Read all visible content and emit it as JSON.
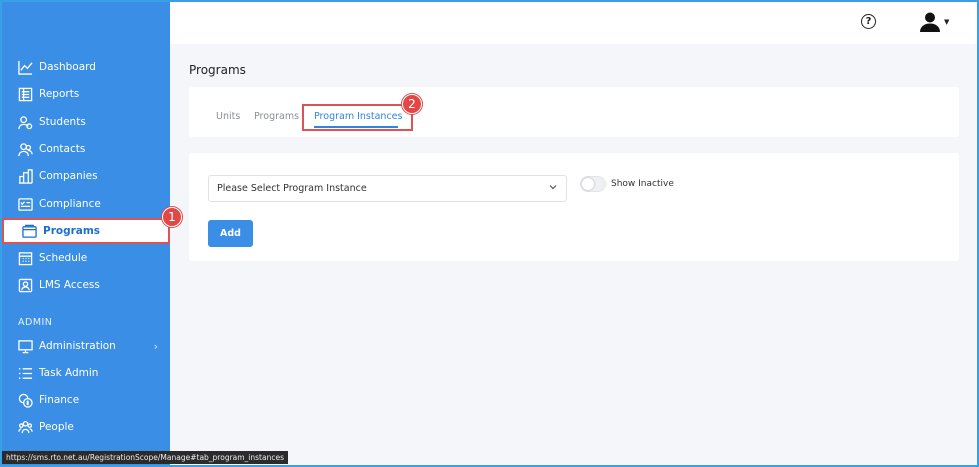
{
  "sidebar": {
    "items": [
      {
        "label": "Dashboard",
        "icon": "chart-line-icon"
      },
      {
        "label": "Reports",
        "icon": "report-icon"
      },
      {
        "label": "Students",
        "icon": "students-icon"
      },
      {
        "label": "Contacts",
        "icon": "contacts-icon"
      },
      {
        "label": "Companies",
        "icon": "building-icon"
      },
      {
        "label": "Compliance",
        "icon": "compliance-icon"
      },
      {
        "label": "Programs",
        "icon": "programs-icon",
        "active": true
      },
      {
        "label": "Schedule",
        "icon": "calendar-icon"
      },
      {
        "label": "LMS Access",
        "icon": "lms-icon"
      }
    ],
    "section_label": "ADMIN",
    "admin_items": [
      {
        "label": "Administration",
        "icon": "monitor-icon",
        "has_chevron": true
      },
      {
        "label": "Task Admin",
        "icon": "list-icon"
      },
      {
        "label": "Finance",
        "icon": "coins-icon"
      },
      {
        "label": "People",
        "icon": "people-icon"
      }
    ]
  },
  "header": {
    "help_symbol": "?",
    "user_caret": "▼"
  },
  "main": {
    "page_title": "Programs",
    "tabs": [
      {
        "label": "Units"
      },
      {
        "label": "Programs"
      },
      {
        "label": "Program Instances",
        "active": true
      }
    ],
    "select_placeholder": "Please Select Program Instance",
    "toggle_label": "Show Inactive",
    "toggle_on": false,
    "add_label": "Add"
  },
  "annotations": {
    "badge_1": "1",
    "badge_2": "2"
  },
  "status_url": "https://sms.rto.net.au/RegistrationScope/Manage#tab_program_instances",
  "colors": {
    "sidebar": "#3a8ee6",
    "accent": "#2f86de",
    "highlight": "#e05252"
  }
}
